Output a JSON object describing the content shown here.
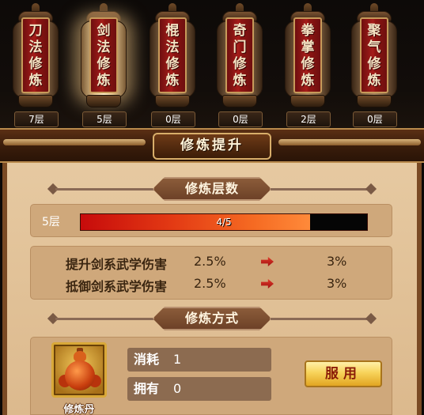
{
  "lanterns": [
    {
      "title": [
        "刀",
        "法",
        "修",
        "炼"
      ],
      "level": "7层",
      "lit": false
    },
    {
      "title": [
        "剑",
        "法",
        "修",
        "炼"
      ],
      "level": "5层",
      "lit": true
    },
    {
      "title": [
        "棍",
        "法",
        "修",
        "炼"
      ],
      "level": "0层",
      "lit": false
    },
    {
      "title": [
        "奇",
        "门",
        "修",
        "炼"
      ],
      "level": "0层",
      "lit": false
    },
    {
      "title": [
        "拳",
        "掌",
        "修",
        "炼"
      ],
      "level": "2层",
      "lit": false
    },
    {
      "title": [
        "聚",
        "气",
        "修",
        "炼"
      ],
      "level": "0层",
      "lit": false
    }
  ],
  "header": {
    "title": "修炼提升"
  },
  "level_section": {
    "title": "修炼层数",
    "current_level": "5层",
    "progress_text": "4/5",
    "progress_fraction": 0.8
  },
  "stats": [
    {
      "name": "提升剑系武学伤害",
      "from": "2.5%",
      "to": "3%"
    },
    {
      "name": "抵御剑系武学伤害",
      "from": "2.5%",
      "to": "3%"
    }
  ],
  "method_section": {
    "title": "修炼方式",
    "item_name": "修炼丹",
    "item_icon": "gourd-pill-icon",
    "cost_label": "消耗",
    "cost_value": "1",
    "owned_label": "拥有",
    "owned_value": "0",
    "use_button": "服用"
  },
  "colors": {
    "accent_red": "#a61d1a",
    "bar_fill_start": "#c70b0b",
    "bar_fill_end": "#ff8a3a",
    "parchment": "#e6c9a1",
    "button_gold": "#f7d35a"
  }
}
